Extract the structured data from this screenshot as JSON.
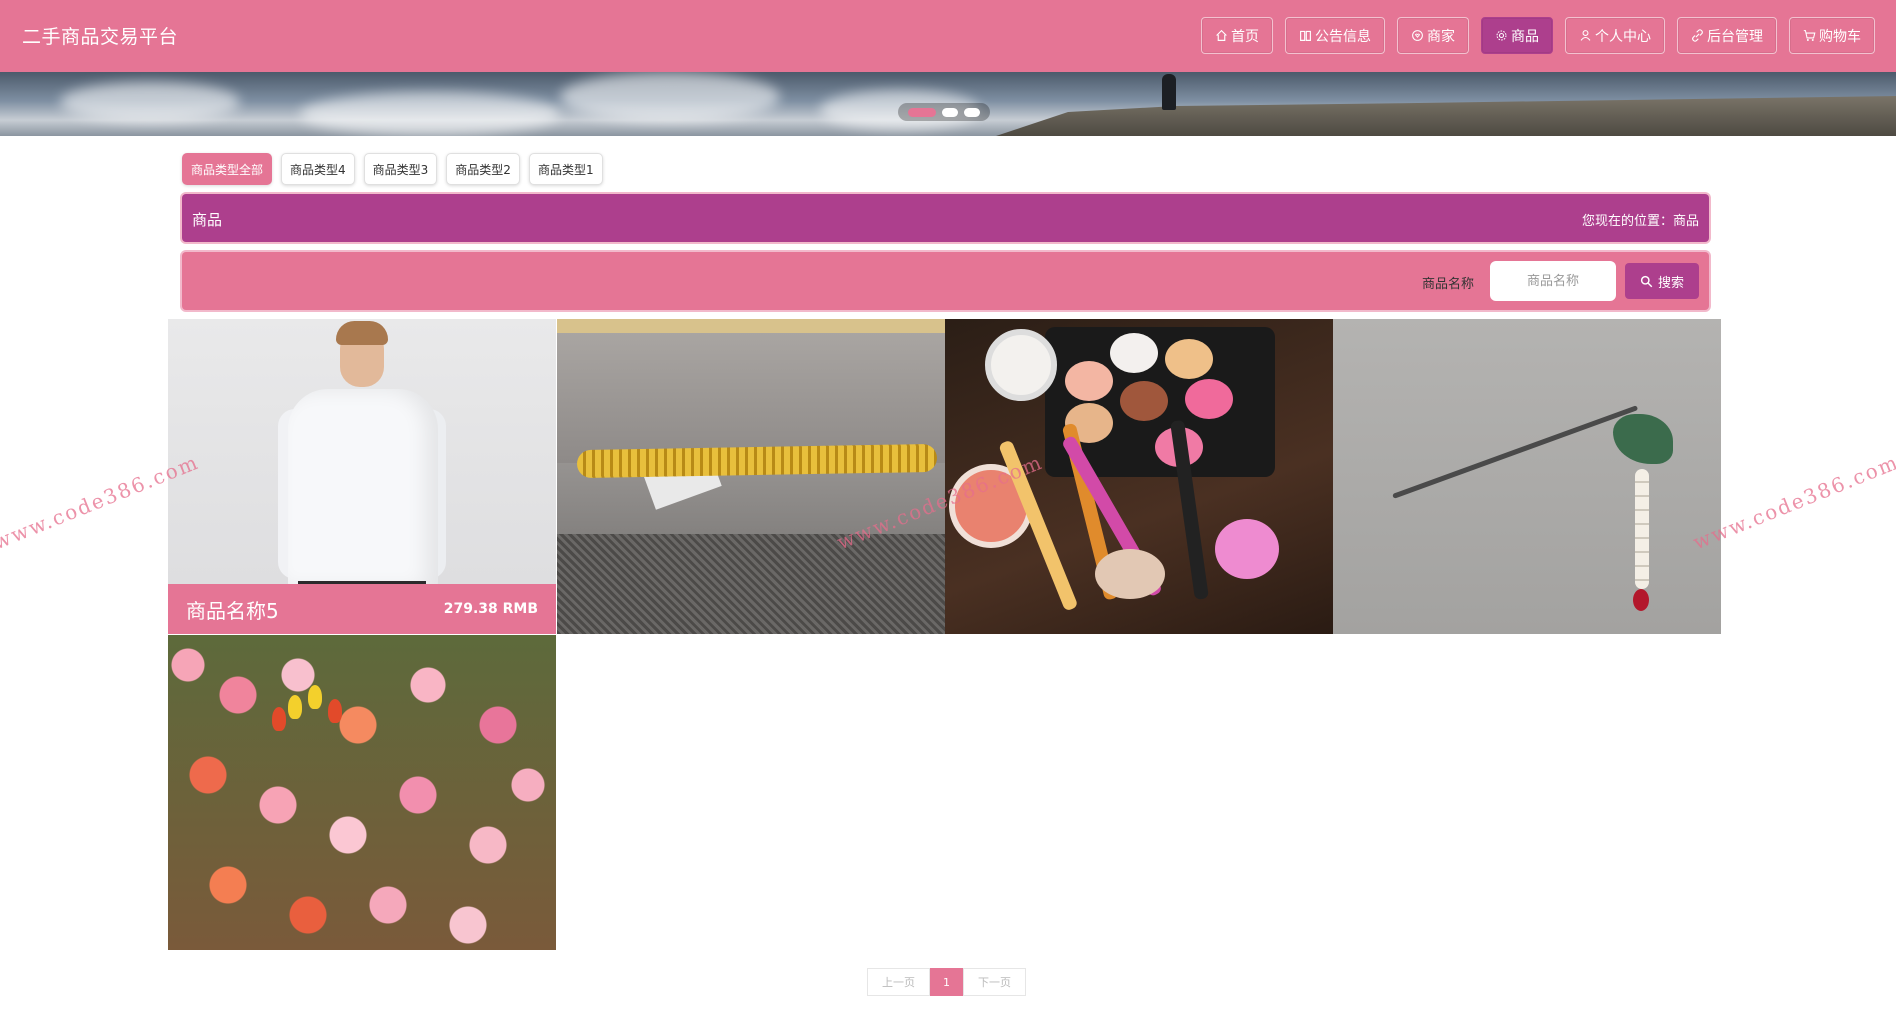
{
  "site": {
    "title": "二手商品交易平台"
  },
  "nav": [
    {
      "label": "首页",
      "icon": "home-icon",
      "active": false
    },
    {
      "label": "公告信息",
      "icon": "book-icon",
      "active": false
    },
    {
      "label": "商家",
      "icon": "heart-icon",
      "active": false
    },
    {
      "label": "商品",
      "icon": "gear-icon",
      "active": true
    },
    {
      "label": "个人中心",
      "icon": "user-icon",
      "active": false
    },
    {
      "label": "后台管理",
      "icon": "link-icon",
      "active": false
    },
    {
      "label": "购物车",
      "icon": "cart-icon",
      "active": false
    }
  ],
  "banner": {
    "slides": 3,
    "active_slide": 1
  },
  "categories": [
    {
      "label": "商品类型全部",
      "active": true
    },
    {
      "label": "商品类型4",
      "active": false
    },
    {
      "label": "商品类型3",
      "active": false
    },
    {
      "label": "商品类型2",
      "active": false
    },
    {
      "label": "商品类型1",
      "active": false
    }
  ],
  "titlebar": {
    "title": "商品",
    "location": "您现在的位置：商品"
  },
  "search": {
    "label": "商品名称",
    "placeholder": "商品名称",
    "value": "",
    "button": "搜索"
  },
  "products": [
    {
      "name": "商品名称5",
      "price": "279.38 RMB",
      "caption_visible": true
    },
    {
      "name": "",
      "price": "",
      "caption_visible": false
    },
    {
      "name": "",
      "price": "",
      "caption_visible": false
    },
    {
      "name": "",
      "price": "",
      "caption_visible": false
    },
    {
      "name": "",
      "price": "",
      "caption_visible": false
    }
  ],
  "watermark": "www.code386.com",
  "pagination": {
    "prev": "上一页",
    "current": "1",
    "next": "下一页"
  },
  "colors": {
    "primary": "#e57595",
    "accent": "#ad3f8d",
    "text": "#333333"
  }
}
